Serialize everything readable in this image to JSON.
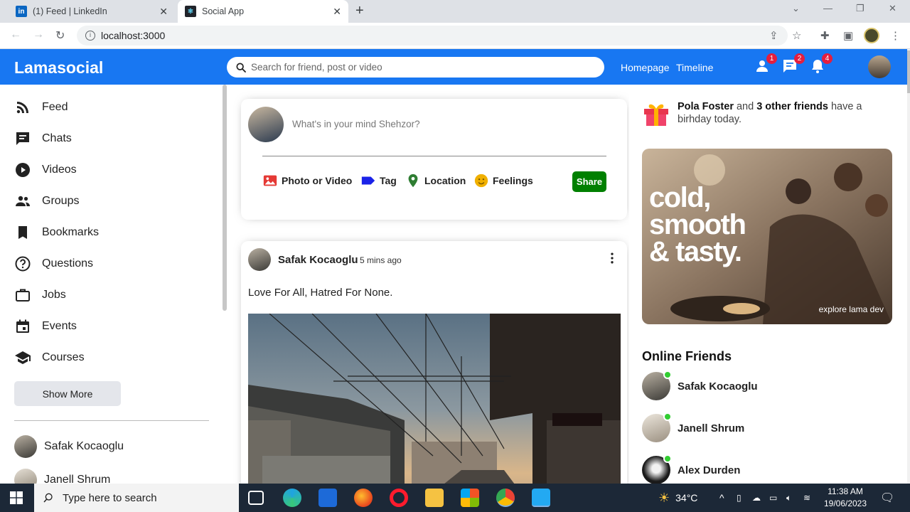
{
  "browser": {
    "tabs": [
      {
        "title": "(1) Feed | LinkedIn",
        "favicon": "linkedin-icon",
        "active": false
      },
      {
        "title": "Social App",
        "favicon": "react-icon",
        "active": true
      }
    ],
    "url": "localhost:3000"
  },
  "topbar": {
    "logo": "Lamasocial",
    "search_placeholder": "Search for friend, post or video",
    "links": [
      "Homepage",
      "Timeline"
    ],
    "badges": {
      "friends": "1",
      "messages": "2",
      "notifications": "4"
    },
    "color": "#1877f2"
  },
  "sidebar": {
    "items": [
      {
        "label": "Feed",
        "icon": "rss-icon"
      },
      {
        "label": "Chats",
        "icon": "chat-icon"
      },
      {
        "label": "Videos",
        "icon": "play-circle-icon"
      },
      {
        "label": "Groups",
        "icon": "group-icon"
      },
      {
        "label": "Bookmarks",
        "icon": "bookmark-icon"
      },
      {
        "label": "Questions",
        "icon": "help-circle-icon"
      },
      {
        "label": "Jobs",
        "icon": "briefcase-icon"
      },
      {
        "label": "Events",
        "icon": "calendar-icon"
      },
      {
        "label": "Courses",
        "icon": "school-icon"
      }
    ],
    "show_more": "Show More",
    "friends": [
      "Safak Kocaoglu",
      "Janell Shrum"
    ]
  },
  "share": {
    "placeholder": "What's in your mind Shehzor?",
    "options": [
      {
        "label": "Photo or Video",
        "icon": "photo-icon",
        "color": "#e53935"
      },
      {
        "label": "Tag",
        "icon": "label-icon",
        "color": "#1a22e8"
      },
      {
        "label": "Location",
        "icon": "location-pin-icon",
        "color": "#2e7d32"
      },
      {
        "label": "Feelings",
        "icon": "emoji-icon",
        "color": "#f0b000"
      }
    ],
    "button": "Share"
  },
  "post": {
    "author": "Safak Kocaoglu",
    "time": "5 mins ago",
    "text": "Love For All, Hatred For None."
  },
  "rightbar": {
    "birthday": {
      "name": "Pola Foster",
      "mid": " and ",
      "others": "3 other friends",
      "tail": " have a birhday today."
    },
    "ad": {
      "line1": "cold,",
      "line2": "smooth",
      "line3": "& tasty.",
      "sub": "explore lama dev"
    },
    "online_title": "Online Friends",
    "online": [
      "Safak Kocaoglu",
      "Janell Shrum",
      "Alex Durden"
    ]
  },
  "taskbar": {
    "search_placeholder": "Type here to search",
    "weather": "34°C",
    "time": "11:38 AM",
    "date": "19/06/2023"
  }
}
